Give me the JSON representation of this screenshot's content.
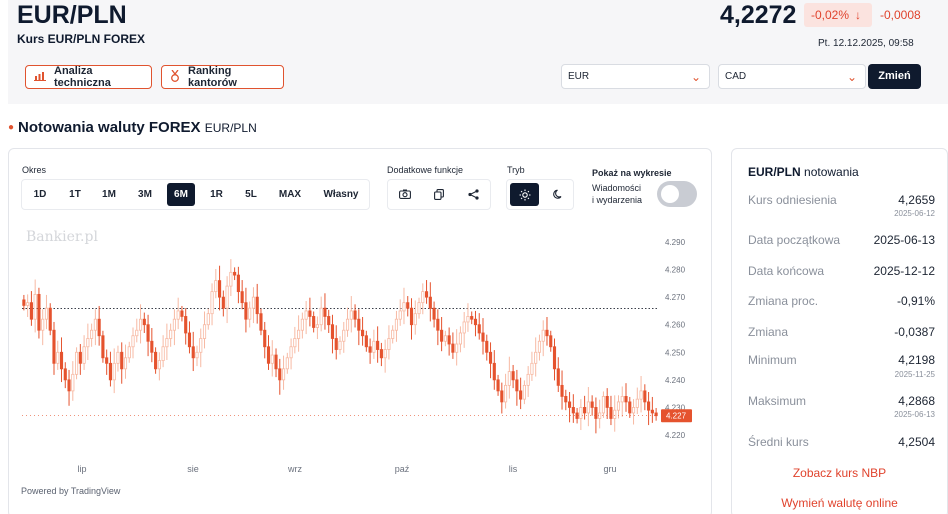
{
  "header": {
    "pair": "EUR/PLN",
    "subtitle": "Kurs EUR/PLN FOREX",
    "price": "4,2272",
    "change_pct": "-0,02%",
    "change_abs": "-0,0008",
    "datetime": "Pt. 12.12.2025, 09:58",
    "btn_analysis": "Analiza techniczna",
    "btn_ranking": "Ranking kantorów",
    "select_from": "EUR",
    "select_to": "CAD",
    "btn_change": "Zmień"
  },
  "section": {
    "title": "Notowania waluty FOREX",
    "subtitle": "EUR/PLN"
  },
  "toolbar": {
    "okres_label": "Okres",
    "periods": [
      "1D",
      "1T",
      "1M",
      "3M",
      "6M",
      "1R",
      "5L",
      "MAX",
      "Własny"
    ],
    "active_period": "6M",
    "functions_label": "Dodatkowe funkcje",
    "mode_label": "Tryb",
    "show_label": "Pokaż na wykresie",
    "news_label_1": "Wiadomości",
    "news_label_2": "i wydarzenia",
    "news_toggle": false
  },
  "chart": {
    "watermark": "Bankier.pl",
    "powered": "Powered by TradingView",
    "current_label": "4.227"
  },
  "chart_data": {
    "type": "candlestick",
    "x_ticks": [
      "lip",
      "sie",
      "wrz",
      "paź",
      "lis",
      "gru"
    ],
    "y_ticks": [
      "4.290",
      "4.280",
      "4.270",
      "4.260",
      "4.250",
      "4.240",
      "4.230",
      "4.220"
    ],
    "ylim": [
      4.218,
      4.292
    ],
    "reference_line": 4.2659,
    "last_price": 4.227,
    "colors": {
      "up": "#f7b9a3",
      "down": "#e5532e"
    },
    "close_series": [
      4.267,
      4.268,
      4.262,
      4.271,
      4.258,
      4.262,
      4.266,
      4.258,
      4.246,
      4.25,
      4.244,
      4.24,
      4.236,
      4.242,
      4.25,
      4.246,
      4.252,
      4.255,
      4.258,
      4.262,
      4.256,
      4.248,
      4.246,
      4.24,
      4.246,
      4.25,
      4.244,
      4.248,
      4.252,
      4.256,
      4.258,
      4.262,
      4.26,
      4.254,
      4.25,
      4.244,
      4.247,
      4.252,
      4.255,
      4.258,
      4.262,
      4.265,
      4.263,
      4.257,
      4.252,
      4.248,
      4.25,
      4.255,
      4.26,
      4.264,
      4.272,
      4.276,
      4.27,
      4.266,
      4.274,
      4.279,
      4.278,
      4.272,
      4.268,
      4.262,
      4.266,
      4.27,
      4.264,
      4.258,
      4.252,
      4.246,
      4.249,
      4.244,
      4.24,
      4.244,
      4.248,
      4.252,
      4.255,
      4.258,
      4.262,
      4.265,
      4.263,
      4.259,
      4.26,
      4.266,
      4.263,
      4.26,
      4.255,
      4.251,
      4.254,
      4.258,
      4.262,
      4.265,
      4.262,
      4.258,
      4.256,
      4.252,
      4.25,
      4.254,
      4.251,
      4.248,
      4.251,
      4.255,
      4.258,
      4.262,
      4.265,
      4.268,
      4.266,
      4.26,
      4.264,
      4.268,
      4.272,
      4.27,
      4.266,
      4.262,
      4.258,
      4.254,
      4.256,
      4.253,
      4.25,
      4.253,
      4.257,
      4.261,
      4.263,
      4.262,
      4.26,
      4.257,
      4.254,
      4.25,
      4.246,
      4.24,
      4.236,
      4.232,
      4.238,
      4.243,
      4.24,
      4.236,
      4.233,
      4.238,
      4.242,
      4.246,
      4.25,
      4.254,
      4.258,
      4.256,
      4.252,
      4.244,
      4.238,
      4.234,
      4.232,
      4.23,
      4.228,
      4.226,
      4.23,
      4.228,
      4.232,
      4.23,
      4.226,
      4.228,
      4.234,
      4.23,
      4.226,
      4.229,
      4.232,
      4.234,
      4.232,
      4.228,
      4.23,
      4.233,
      4.236,
      4.232,
      4.229,
      4.228,
      4.227
    ]
  },
  "side": {
    "title_pair": "EUR/PLN",
    "title_word": "notowania",
    "rows": [
      {
        "label": "Kurs odniesienia",
        "value": "4,2659",
        "date": "2025-06-12"
      },
      {
        "label": "Data początkowa",
        "value": "2025-06-13",
        "date": ""
      },
      {
        "label": "Data końcowa",
        "value": "2025-12-12",
        "date": ""
      },
      {
        "label": "Zmiana proc.",
        "value": "-0,91%",
        "date": ""
      },
      {
        "label": "Zmiana",
        "value": "-0,0387",
        "date": ""
      },
      {
        "label": "Minimum",
        "value": "4,2198",
        "date": "2025-11-25"
      },
      {
        "label": "Maksimum",
        "value": "4,2868",
        "date": "2025-06-13"
      },
      {
        "label": "Średni kurs",
        "value": "4,2504",
        "date": ""
      }
    ],
    "link_nbp": "Zobacz kurs NBP",
    "link_exchange": "Wymień walutę online"
  }
}
